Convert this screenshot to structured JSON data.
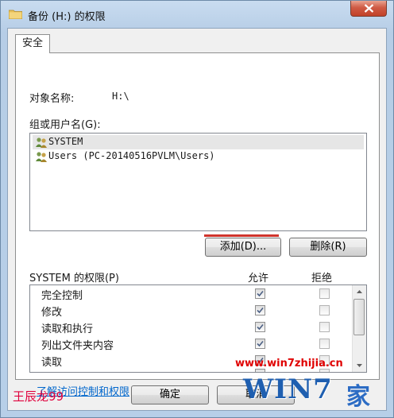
{
  "window": {
    "title": "备份 (H:) 的权限"
  },
  "tabs": [
    {
      "label": "安全"
    }
  ],
  "object": {
    "label": "对象名称:",
    "value": "H:\\"
  },
  "groups": {
    "label": "组或用户名(G):",
    "items": [
      {
        "name": "SYSTEM",
        "selected": true
      },
      {
        "name": "Users (PC-20140516PVLM\\Users)",
        "selected": false
      }
    ]
  },
  "actions": {
    "add": "添加(D)...",
    "remove": "删除(R)"
  },
  "permissions": {
    "title": "SYSTEM 的权限(P)",
    "allow_header": "允许",
    "deny_header": "拒绝",
    "rows": [
      {
        "name": "完全控制",
        "allow": true,
        "deny": false
      },
      {
        "name": "修改",
        "allow": true,
        "deny": false
      },
      {
        "name": "读取和执行",
        "allow": true,
        "deny": false
      },
      {
        "name": "列出文件夹内容",
        "allow": true,
        "deny": false
      },
      {
        "name": "读取",
        "allow": true,
        "deny": false
      }
    ]
  },
  "link": "了解访问控制和权限",
  "buttons": {
    "ok": "确定",
    "cancel": "取消"
  },
  "watermarks": {
    "author": "王辰龙99",
    "site": "www.win7zhijia.cn",
    "logo": "WIN7",
    "logo_suffix": "家"
  },
  "colors": {
    "link": "#0066cc",
    "accent_underline": "#d0342c",
    "close_button": "#c24128"
  }
}
